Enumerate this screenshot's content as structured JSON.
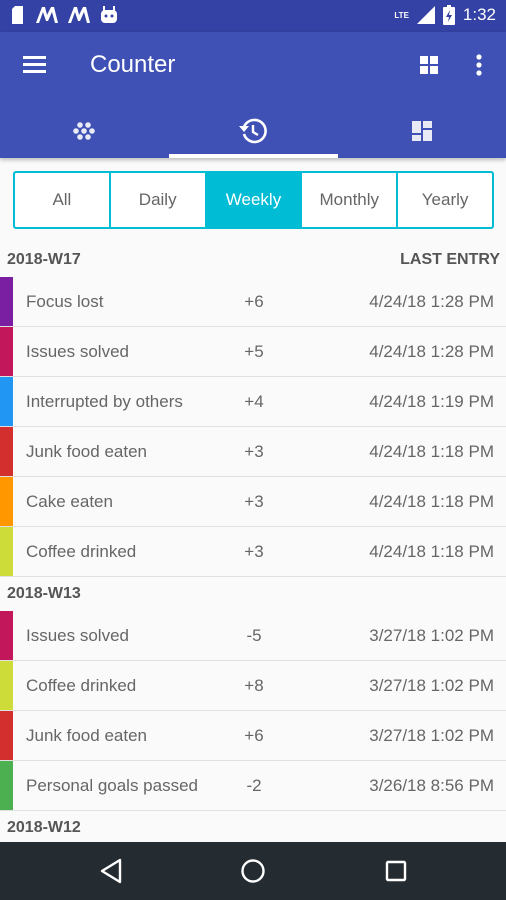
{
  "status_bar": {
    "time": "1:32",
    "network": "LTE"
  },
  "app_bar": {
    "title": "Counter",
    "menu_icon": "hamburger-menu-icon",
    "grid_icon": "dashboard-grid-icon",
    "more_icon": "more-vert-icon",
    "background": "#3f51b5",
    "status_background": "#3342a4"
  },
  "tabs": [
    {
      "icon": "dots-cluster-icon",
      "selected": false
    },
    {
      "icon": "history-icon",
      "selected": true
    },
    {
      "icon": "dashboard-icon",
      "selected": false
    }
  ],
  "filter": {
    "options": [
      "All",
      "Daily",
      "Weekly",
      "Monthly",
      "Yearly"
    ],
    "selected": "Weekly",
    "accent": "#00bcd4"
  },
  "sections": [
    {
      "title": "2018-W17",
      "right_label": "LAST ENTRY",
      "rows": [
        {
          "name": "Focus lost",
          "delta": "+6",
          "date": "4/24/18 1:28 PM",
          "color": "#7b1fa2"
        },
        {
          "name": "Issues solved",
          "delta": "+5",
          "date": "4/24/18 1:28 PM",
          "color": "#c2185b"
        },
        {
          "name": "Interrupted by others",
          "delta": "+4",
          "date": "4/24/18 1:19 PM",
          "color": "#2196f3"
        },
        {
          "name": "Junk food eaten",
          "delta": "+3",
          "date": "4/24/18 1:18 PM",
          "color": "#d32f2f"
        },
        {
          "name": "Cake eaten",
          "delta": "+3",
          "date": "4/24/18 1:18 PM",
          "color": "#ff9800"
        },
        {
          "name": "Coffee drinked",
          "delta": "+3",
          "date": "4/24/18 1:18 PM",
          "color": "#cddc39"
        }
      ]
    },
    {
      "title": "2018-W13",
      "right_label": "",
      "rows": [
        {
          "name": "Issues solved",
          "delta": "-5",
          "date": "3/27/18 1:02 PM",
          "color": "#c2185b"
        },
        {
          "name": "Coffee drinked",
          "delta": "+8",
          "date": "3/27/18 1:02 PM",
          "color": "#cddc39"
        },
        {
          "name": "Junk food eaten",
          "delta": "+6",
          "date": "3/27/18 1:02 PM",
          "color": "#d32f2f"
        },
        {
          "name": "Personal goals passed",
          "delta": "-2",
          "date": "3/26/18 8:56 PM",
          "color": "#4caf50"
        }
      ]
    },
    {
      "title": "2018-W12",
      "right_label": "",
      "rows": []
    }
  ],
  "nav_bar": {
    "back_icon": "back-triangle-icon",
    "home_icon": "home-circle-icon",
    "recents_icon": "recents-square-icon"
  }
}
